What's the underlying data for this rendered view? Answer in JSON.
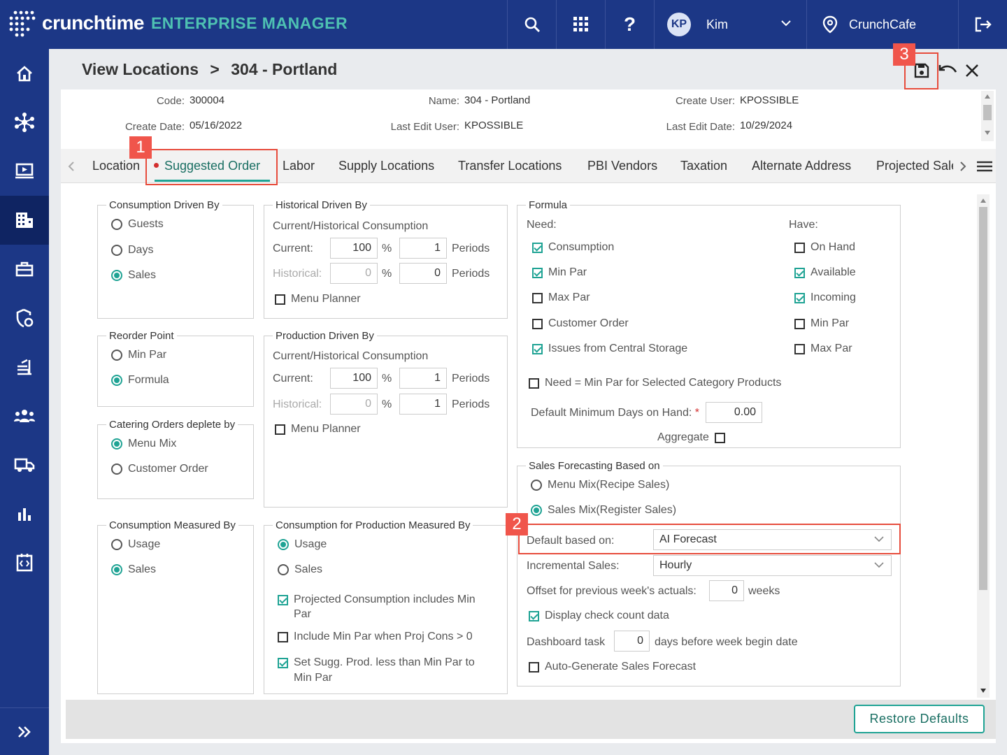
{
  "header": {
    "brand": "crunchtime",
    "product": "ENTERPRISE MANAGER",
    "user_initials": "KP",
    "user_name": "Kim",
    "location": "CrunchCafe"
  },
  "breadcrumb": {
    "parent": "View Locations",
    "separator": ">",
    "current": "304 - Portland"
  },
  "meta": {
    "code_label": "Code:",
    "code": "300004",
    "name_label": "Name:",
    "name": "304 - Portland",
    "create_user_label": "Create User:",
    "create_user": "KPOSSIBLE",
    "create_date_label": "Create Date:",
    "create_date": "05/16/2022",
    "last_edit_user_label": "Last Edit User:",
    "last_edit_user": "KPOSSIBLE",
    "last_edit_date_label": "Last Edit Date:",
    "last_edit_date": "10/29/2024"
  },
  "tabs": [
    "Location",
    "Suggested Order",
    "Labor",
    "Supply Locations",
    "Transfer Locations",
    "PBI Vendors",
    "Taxation",
    "Alternate Address",
    "Projected Sale"
  ],
  "consumption_driven": {
    "legend": "Consumption Driven By",
    "options": [
      "Guests",
      "Days",
      "Sales"
    ],
    "selected": "Sales"
  },
  "reorder_point": {
    "legend": "Reorder Point",
    "options": [
      "Min Par",
      "Formula"
    ],
    "selected": "Formula"
  },
  "catering": {
    "legend": "Catering Orders deplete by",
    "options": [
      "Menu Mix",
      "Customer Order"
    ],
    "selected": "Menu Mix"
  },
  "consumption_measured": {
    "legend": "Consumption Measured By",
    "options": [
      "Usage",
      "Sales"
    ],
    "selected": "Sales"
  },
  "historical": {
    "legend": "Historical Driven By",
    "sub": "Current/Historical Consumption",
    "current_label": "Current:",
    "current_pct": "100",
    "current_periods": "1",
    "historical_label": "Historical:",
    "historical_pct": "0",
    "historical_periods": "0",
    "pct": "%",
    "periods": "Periods",
    "menu_planner": "Menu Planner"
  },
  "production": {
    "legend": "Production Driven By",
    "sub": "Current/Historical Consumption",
    "current_label": "Current:",
    "current_pct": "100",
    "current_periods": "1",
    "historical_label": "Historical:",
    "historical_pct": "0",
    "historical_periods": "1",
    "pct": "%",
    "periods": "Periods",
    "menu_planner": "Menu Planner"
  },
  "cons_prod": {
    "legend": "Consumption for Production Measured By",
    "options": [
      "Usage",
      "Sales"
    ],
    "selected": "Usage",
    "check1": "Projected Consumption includes Min",
    "check1b": "Par",
    "check2": "Include Min Par when Proj Cons > 0",
    "check3": "Set Sugg. Prod. less than Min Par to",
    "check3b": "Min Par"
  },
  "formula": {
    "legend": "Formula",
    "need_label": "Need:",
    "have_label": "Have:",
    "need": [
      "Consumption",
      "Min Par",
      "Max Par",
      "Customer Order",
      "Issues from Central Storage"
    ],
    "have": [
      "On Hand",
      "Available",
      "Incoming",
      "Min Par",
      "Max Par"
    ],
    "need_min_par": "Need = Min Par for Selected Category Products",
    "default_min_days_label": "Default Minimum Days on Hand:",
    "required_mark": "*",
    "default_min_days": "0.00",
    "aggregate": "Aggregate"
  },
  "sales_forecast": {
    "legend": "Sales Forecasting Based on",
    "options": [
      "Menu Mix(Recipe Sales)",
      "Sales Mix(Register Sales)"
    ],
    "selected": "Sales Mix(Register Sales)",
    "default_label": "Default based on:",
    "default_value": "AI Forecast",
    "incremental_label": "Incremental Sales:",
    "incremental_value": "Hourly",
    "offset_label": "Offset for previous week's actuals:",
    "offset_value": "0",
    "weeks": "weeks",
    "display_check": "Display check count data",
    "dashboard_label": "Dashboard task",
    "dashboard_value": "0",
    "dashboard_suffix": "days before week begin date",
    "auto_generate": "Auto-Generate Sales Forecast"
  },
  "footer": {
    "restore": "Restore Defaults"
  },
  "callouts": [
    "1",
    "2",
    "3"
  ],
  "colors": {
    "nav": "#1c3786",
    "accent": "#1fa394",
    "callout": "#e74c3c"
  }
}
